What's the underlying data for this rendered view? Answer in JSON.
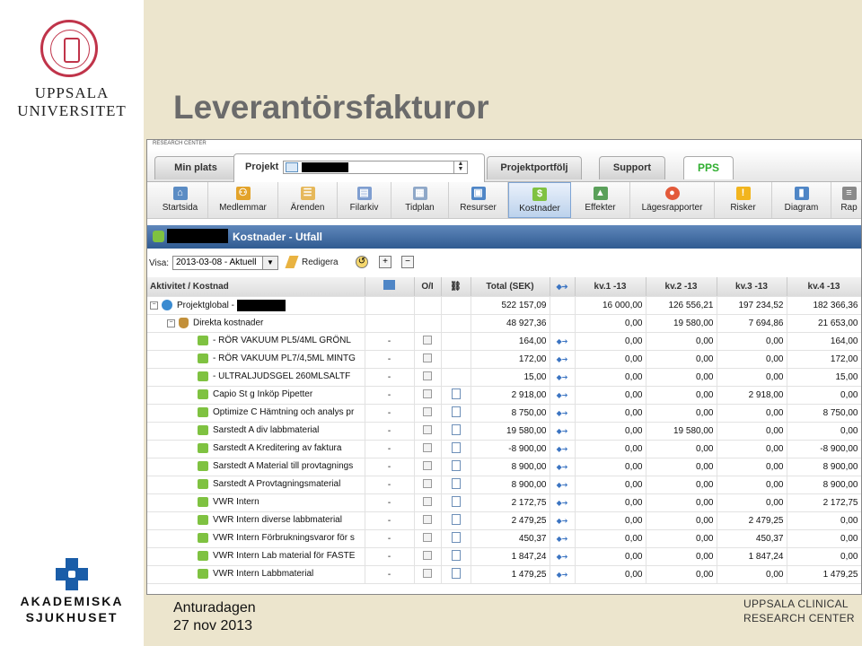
{
  "slide": {
    "title": "Leverantörsfakturor",
    "footer_line1": "Anturadagen",
    "footer_line2": "27 nov 2013"
  },
  "logos": {
    "uu_line1": "UPPSALA",
    "uu_line2": "UNIVERSITET",
    "ak_line1": "AKADEMISKA",
    "ak_line2": "SJUKHUSET",
    "ucr_line1": "UPPSALA CLINICAL",
    "ucr_line2": "RESEARCH CENTER"
  },
  "app": {
    "header_small": "RESEARCH CENTER",
    "tabs": [
      {
        "label": "Min plats"
      },
      {
        "label": "Projekt"
      },
      {
        "label": "Projektportfölj"
      },
      {
        "label": "Support"
      },
      {
        "label": "PPS"
      }
    ],
    "toolbar": [
      {
        "label": "Startsida",
        "icon": "home-icon"
      },
      {
        "label": "Medlemmar",
        "icon": "members-icon"
      },
      {
        "label": "Ärenden",
        "icon": "issues-icon"
      },
      {
        "label": "Filarkiv",
        "icon": "file-archive-icon"
      },
      {
        "label": "Tidplan",
        "icon": "schedule-icon"
      },
      {
        "label": "Resurser",
        "icon": "resources-icon"
      },
      {
        "label": "Kostnader",
        "icon": "costs-icon"
      },
      {
        "label": "Effekter",
        "icon": "effects-icon"
      },
      {
        "label": "Lägesrapporter",
        "icon": "status-report-icon"
      },
      {
        "label": "Risker",
        "icon": "risks-icon"
      },
      {
        "label": "Diagram",
        "icon": "diagram-icon"
      },
      {
        "label": "Rap",
        "icon": "report-icon"
      }
    ],
    "section_title": "Kostnader - Utfall",
    "filter": {
      "label": "Visa:",
      "selected": "2013-03-08 - Aktuell",
      "edit_label": "Redigera"
    },
    "columns": {
      "name": "Aktivitet / Kostnad",
      "oi": "O/I",
      "total": "Total (SEK)",
      "q1": "kv.1 -13",
      "q2": "kv.2 -13",
      "q3": "kv.3 -13",
      "q4": "kv.4 -13"
    },
    "rows": [
      {
        "name": "Projektglobal -",
        "oi": "",
        "total": "522 157,09",
        "q1": "16 000,00",
        "q2": "126 556,21",
        "q3": "197 234,52",
        "q4": "182 366,36"
      },
      {
        "name": "Direkta kostnader",
        "oi": "",
        "total": "48 927,36",
        "q1": "0,00",
        "q2": "19 580,00",
        "q3": "7 694,86",
        "q4": "21 653,00"
      },
      {
        "name": "- RÖR VAKUUM PL5/4ML GRÖNL",
        "oi": "-",
        "total": "164,00",
        "q1": "0,00",
        "q2": "0,00",
        "q3": "0,00",
        "q4": "164,00"
      },
      {
        "name": "- RÖR VAKUUM PL7/4,5ML MINTG",
        "oi": "-",
        "total": "172,00",
        "q1": "0,00",
        "q2": "0,00",
        "q3": "0,00",
        "q4": "172,00"
      },
      {
        "name": "- ULTRALJUDSGEL 260MLSALTF",
        "oi": "-",
        "total": "15,00",
        "q1": "0,00",
        "q2": "0,00",
        "q3": "0,00",
        "q4": "15,00"
      },
      {
        "name": "Capio St g Inköp Pipetter",
        "oi": "-",
        "total": "2 918,00",
        "q1": "0,00",
        "q2": "0,00",
        "q3": "2 918,00",
        "q4": "0,00"
      },
      {
        "name": "Optimize C Hämtning och analys pr",
        "oi": "-",
        "total": "8 750,00",
        "q1": "0,00",
        "q2": "0,00",
        "q3": "0,00",
        "q4": "8 750,00"
      },
      {
        "name": "Sarstedt A div labbmaterial",
        "oi": "-",
        "total": "19 580,00",
        "q1": "0,00",
        "q2": "19 580,00",
        "q3": "0,00",
        "q4": "0,00"
      },
      {
        "name": "Sarstedt A Kreditering av faktura",
        "oi": "-",
        "total": "-8 900,00",
        "q1": "0,00",
        "q2": "0,00",
        "q3": "0,00",
        "q4": "-8 900,00"
      },
      {
        "name": "Sarstedt A Material till provtagnings",
        "oi": "-",
        "total": "8 900,00",
        "q1": "0,00",
        "q2": "0,00",
        "q3": "0,00",
        "q4": "8 900,00"
      },
      {
        "name": "Sarstedt A Provtagningsmaterial",
        "oi": "-",
        "total": "8 900,00",
        "q1": "0,00",
        "q2": "0,00",
        "q3": "0,00",
        "q4": "8 900,00"
      },
      {
        "name": "VWR Intern",
        "oi": "-",
        "total": "2 172,75",
        "q1": "0,00",
        "q2": "0,00",
        "q3": "0,00",
        "q4": "2 172,75"
      },
      {
        "name": "VWR Intern diverse labbmaterial",
        "oi": "-",
        "total": "2 479,25",
        "q1": "0,00",
        "q2": "0,00",
        "q3": "2 479,25",
        "q4": "0,00"
      },
      {
        "name": "VWR Intern Förbrukningsvaror för s",
        "oi": "-",
        "total": "450,37",
        "q1": "0,00",
        "q2": "0,00",
        "q3": "450,37",
        "q4": "0,00"
      },
      {
        "name": "VWR Intern Lab material för FASTE",
        "oi": "-",
        "total": "1 847,24",
        "q1": "0,00",
        "q2": "0,00",
        "q3": "1 847,24",
        "q4": "0,00"
      },
      {
        "name": "VWR Intern Labbmaterial",
        "oi": "-",
        "total": "1 479,25",
        "q1": "0,00",
        "q2": "0,00",
        "q3": "0,00",
        "q4": "1 479,25"
      }
    ]
  },
  "colors": {
    "slide_bg": "#ece5cd",
    "title_gray": "#6b6b6b",
    "header_blue": "#305b91",
    "pps_green": "#2fae2f",
    "uu_red": "#c0344a",
    "ak_blue": "#1a5da8"
  }
}
